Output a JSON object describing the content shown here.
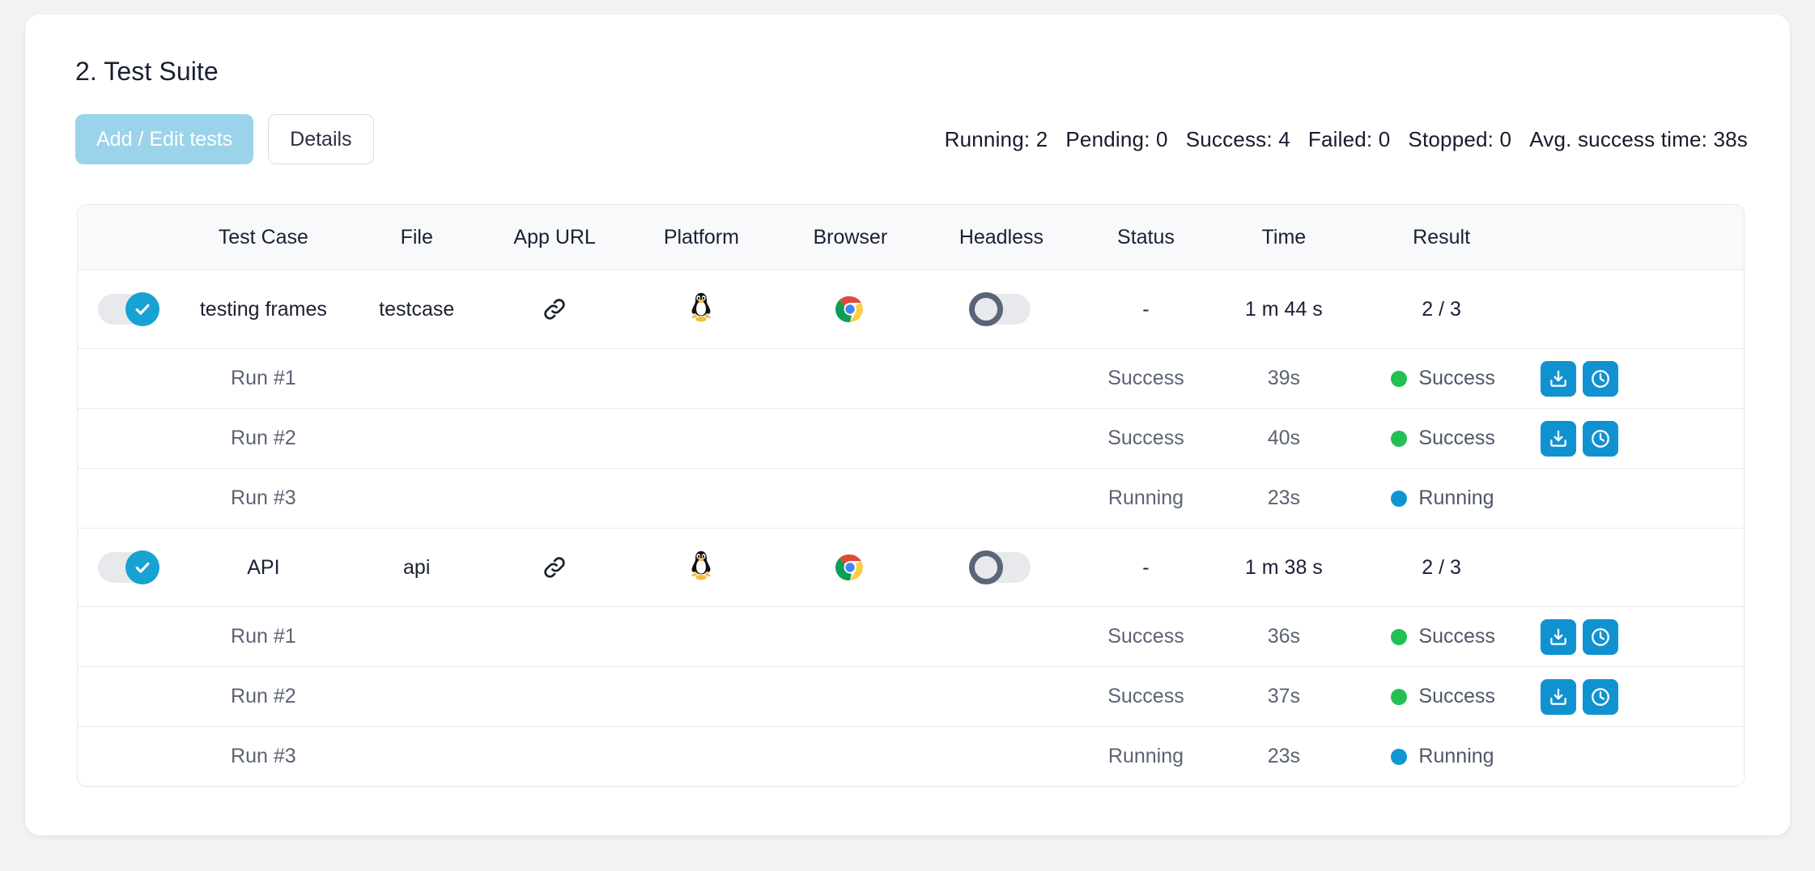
{
  "section": {
    "title": "2. Test Suite"
  },
  "toolbar": {
    "add_edit_label": "Add / Edit tests",
    "details_label": "Details"
  },
  "stats": {
    "running": "Running: 2",
    "pending": "Pending: 0",
    "success": "Success: 4",
    "failed": "Failed: 0",
    "stopped": "Stopped: 0",
    "avg_success_time": "Avg. success time: 38s"
  },
  "table": {
    "columns": [
      "",
      "Test Case",
      "File",
      "App URL",
      "Platform",
      "Browser",
      "Headless",
      "Status",
      "Time",
      "Result",
      ""
    ],
    "tests": [
      {
        "enabled_toggle": "on",
        "name": "testing frames",
        "file": "testcase",
        "app_url_icon": "link-icon",
        "platform_icon": "linux-penguin-icon",
        "browser_icon": "chrome-icon",
        "headless_toggle": "off",
        "status": "-",
        "time": "1 m 44 s",
        "result": "2 / 3",
        "runs": [
          {
            "label": "Run #1",
            "status": "Success",
            "time": "39s",
            "result": "Success",
            "result_state": "success",
            "has_actions": true,
            "actions": [
              "download-icon",
              "clock-icon"
            ]
          },
          {
            "label": "Run #2",
            "status": "Success",
            "time": "40s",
            "result": "Success",
            "result_state": "success",
            "has_actions": true,
            "actions": [
              "download-icon",
              "clock-icon"
            ]
          },
          {
            "label": "Run #3",
            "status": "Running",
            "time": "23s",
            "result": "Running",
            "result_state": "running",
            "has_actions": false,
            "actions": []
          }
        ]
      },
      {
        "enabled_toggle": "on",
        "name": "API",
        "file": "api",
        "app_url_icon": "link-icon",
        "platform_icon": "linux-penguin-icon",
        "browser_icon": "chrome-icon",
        "headless_toggle": "off",
        "status": "-",
        "time": "1 m 38 s",
        "result": "2 / 3",
        "runs": [
          {
            "label": "Run #1",
            "status": "Success",
            "time": "36s",
            "result": "Success",
            "result_state": "success",
            "has_actions": true,
            "actions": [
              "download-icon",
              "clock-icon"
            ]
          },
          {
            "label": "Run #2",
            "status": "Success",
            "time": "37s",
            "result": "Success",
            "result_state": "success",
            "has_actions": true,
            "actions": [
              "download-icon",
              "clock-icon"
            ]
          },
          {
            "label": "Run #3",
            "status": "Running",
            "time": "23s",
            "result": "Running",
            "result_state": "running",
            "has_actions": false,
            "actions": []
          }
        ]
      }
    ]
  },
  "colors": {
    "accent_blue": "#1192d0",
    "primary_button": "#9bd3ea",
    "success_green": "#22c052",
    "running_blue": "#0e96d4",
    "page_bg": "#f2f2f3",
    "card_bg": "#ffffff",
    "header_row_bg": "#f8f9fb"
  }
}
